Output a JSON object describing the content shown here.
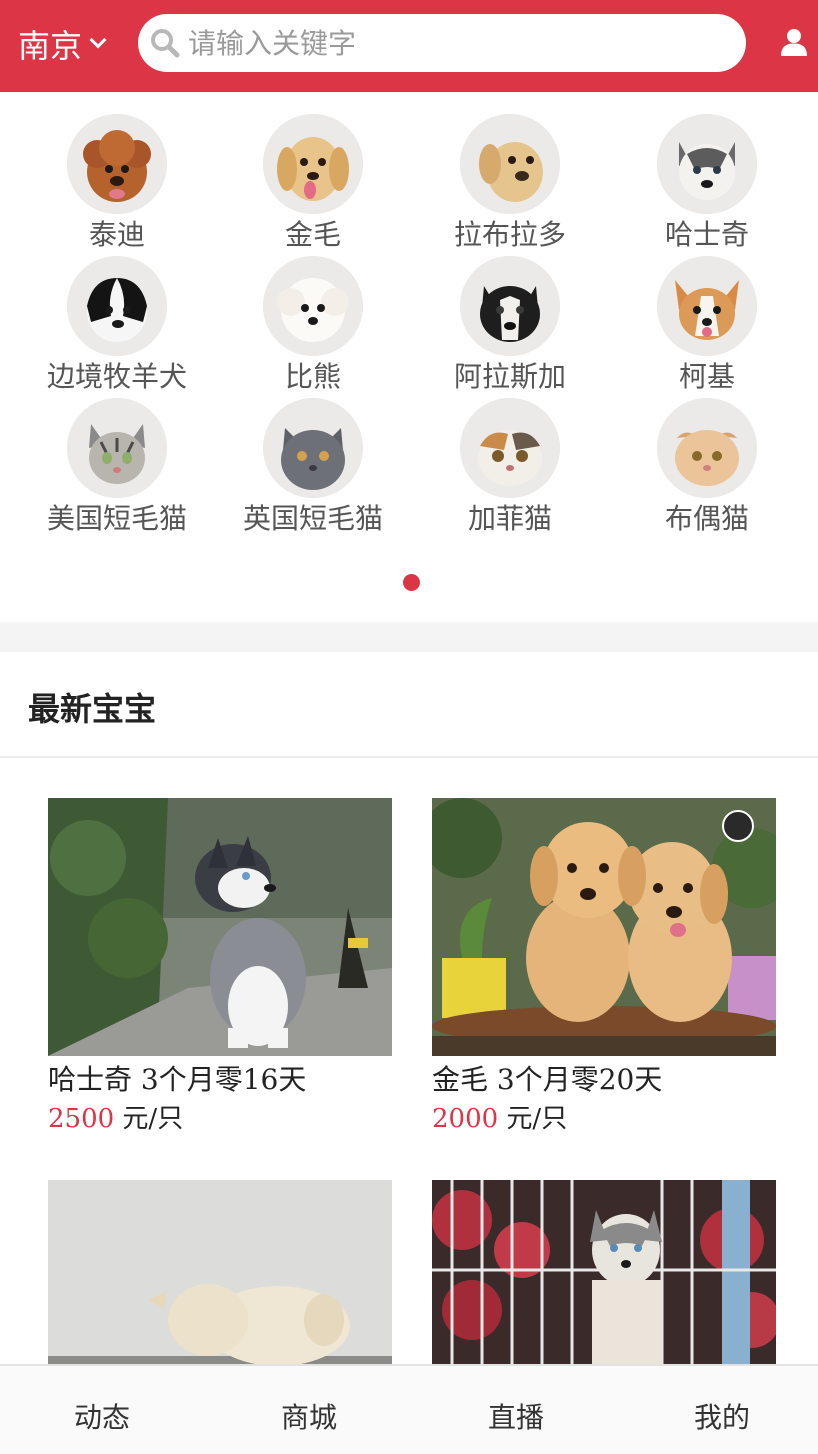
{
  "header": {
    "city": "南京",
    "search_placeholder": "请输入关键字"
  },
  "categories": [
    {
      "label": "泰迪",
      "icon": "teddy-photo"
    },
    {
      "label": "金毛",
      "icon": "golden-retriever-photo"
    },
    {
      "label": "拉布拉多",
      "icon": "labrador-photo"
    },
    {
      "label": "哈士奇",
      "icon": "husky-photo"
    },
    {
      "label": "边境牧羊犬",
      "icon": "border-collie-photo"
    },
    {
      "label": "比熊",
      "icon": "bichon-photo"
    },
    {
      "label": "阿拉斯加",
      "icon": "alaskan-malamute-photo"
    },
    {
      "label": "柯基",
      "icon": "corgi-photo"
    },
    {
      "label": "美国短毛猫",
      "icon": "american-shorthair-photo"
    },
    {
      "label": "英国短毛猫",
      "icon": "british-shorthair-photo"
    },
    {
      "label": "加菲猫",
      "icon": "exotic-shorthair-photo"
    },
    {
      "label": "布偶猫",
      "icon": "ragdoll-photo"
    }
  ],
  "pagination": {
    "pages": 1,
    "active": 1
  },
  "section": {
    "title": "最新宝宝"
  },
  "products": [
    {
      "title": "哈士奇 3个月零16天",
      "price": "2500",
      "unit": " 元/只"
    },
    {
      "title": "金毛 3个月零20天",
      "price": "2000",
      "unit": " 元/只"
    },
    {
      "title": "",
      "price": "",
      "unit": ""
    },
    {
      "title": "",
      "price": "",
      "unit": ""
    }
  ],
  "bottom_nav": [
    {
      "label": "动态"
    },
    {
      "label": "商城"
    },
    {
      "label": "直播"
    },
    {
      "label": "我的"
    }
  ],
  "colors": {
    "accent": "#dc3545",
    "price": "#dc3545",
    "divider": "#f4f4f4"
  }
}
